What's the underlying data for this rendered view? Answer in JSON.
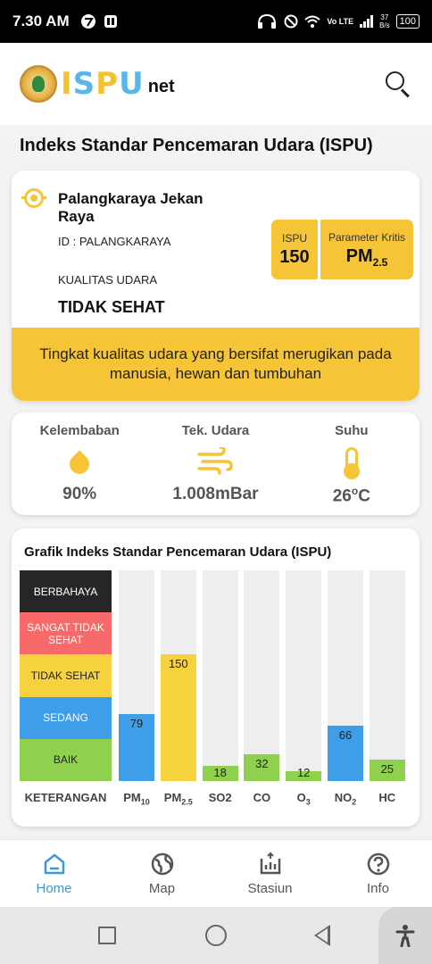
{
  "status_bar": {
    "time": "7.30 AM",
    "network": "Vo LTE",
    "speed_value": "37",
    "speed_unit": "B/s",
    "battery": "100"
  },
  "header": {
    "logo_letters": [
      "I",
      "S",
      "P",
      "U"
    ],
    "logo_suffix": "net"
  },
  "page_title": "Indeks Standar Pencemaran Udara (ISPU)",
  "station": {
    "name": "Palangkaraya Jekan Raya",
    "id": "ID : PALANGKARAYA",
    "quality_label": "KUALITAS UDARA",
    "quality_value": "TIDAK SEHAT",
    "ispu_label": "ISPU",
    "ispu_value": "150",
    "param_label": "Parameter Kritis",
    "param_value": "PM",
    "param_sub": "2.5",
    "description": "Tingkat kualitas udara yang bersifat merugikan pada manusia, hewan dan tumbuhan",
    "accent": "#f6c437"
  },
  "weather": [
    {
      "label": "Kelembaban",
      "value": "90%",
      "icon": "drop-icon"
    },
    {
      "label": "Tek. Udara",
      "value": "1.008mBar",
      "icon": "wind-icon"
    },
    {
      "label": "Suhu",
      "value": "26",
      "unit_sup": "o",
      "unit": "C",
      "icon": "thermometer-icon"
    }
  ],
  "chart_data": {
    "type": "bar",
    "title": "Grafik Indeks Standar Pencemaran Udara (ISPU)",
    "legend_header": "KETERANGAN",
    "categories": [
      {
        "main": "PM",
        "sub": "10"
      },
      {
        "main": "PM",
        "sub": "2.5"
      },
      {
        "main": "SO2",
        "sub": ""
      },
      {
        "main": "CO",
        "sub": ""
      },
      {
        "main": "O",
        "sub": "3"
      },
      {
        "main": "NO",
        "sub": "2"
      },
      {
        "main": "HC",
        "sub": ""
      }
    ],
    "values": [
      79,
      150,
      18,
      32,
      12,
      66,
      25
    ],
    "bar_colors": [
      "#3e9ee8",
      "#f6d23f",
      "#8fd14f",
      "#8fd14f",
      "#8fd14f",
      "#3e9ee8",
      "#8fd14f"
    ],
    "ylim": [
      0,
      250
    ],
    "levels": [
      {
        "label": "BERBAHAYA",
        "color": "#262626",
        "text_color": "#ffffff"
      },
      {
        "label": "SANGAT TIDAK SEHAT",
        "color": "#f86a6a",
        "text_color": "#ffffff"
      },
      {
        "label": "TIDAK SEHAT",
        "color": "#f6d23f",
        "text_color": "#222222"
      },
      {
        "label": "SEDANG",
        "color": "#3e9ee8",
        "text_color": "#ffffff"
      },
      {
        "label": "BAIK",
        "color": "#8fd14f",
        "text_color": "#222222"
      }
    ]
  },
  "bottom_nav": [
    {
      "label": "Home",
      "icon": "home-icon",
      "active": true
    },
    {
      "label": "Map",
      "icon": "globe-icon",
      "active": false
    },
    {
      "label": "Stasiun",
      "icon": "chart-icon",
      "active": false
    },
    {
      "label": "Info",
      "icon": "help-icon",
      "active": false
    }
  ]
}
